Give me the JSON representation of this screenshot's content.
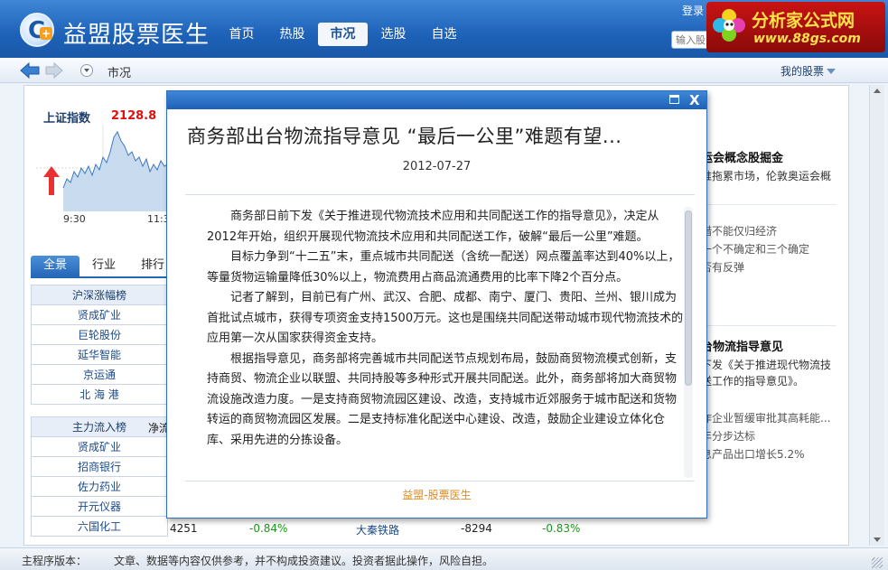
{
  "app": {
    "title": "益盟股票医生",
    "login": "登录",
    "search_placeholder": "输入股"
  },
  "nav": {
    "items": [
      "首页",
      "热股",
      "市况",
      "选股",
      "自选"
    ],
    "active_index": 2
  },
  "watermark": {
    "title": "分析家公式网",
    "url": "www.88gs.com"
  },
  "toolbar": {
    "breadcrumb": "市况",
    "my_stocks": "我的股票"
  },
  "index": {
    "name": "上证指数",
    "value": "2128.8",
    "time_start": "9:30",
    "time_mid": "11:3"
  },
  "subtabs": [
    "全景",
    "行业",
    "排行"
  ],
  "table1": {
    "header": "沪深涨幅榜",
    "rows": [
      "贤成矿业",
      "巨轮股份",
      "延华智能",
      "京运通",
      "北 海 港"
    ]
  },
  "table2": {
    "header": "主力流入榜",
    "header2": "净流",
    "rows": [
      "贤成矿业",
      "招商银行",
      "佐力药业",
      "开元仪器",
      "六国化工"
    ]
  },
  "bottom_row": {
    "amount1": "4251",
    "pct1": "-0.84%",
    "name2": "大秦铁路",
    "amount2": "-8294",
    "pct2": "-0.83%"
  },
  "right_panel": {
    "headline1": "运会概念股掘金",
    "line1": "推拖累市场，伦敦奥运会概",
    "items1": [
      "措不能仅归经济",
      "一个不确定和三个确定",
      "否有反弹"
    ],
    "headline2": "台物流指导意见",
    "line2a": "下发《关于推进现代物流技",
    "line2b": "送工作的指导意见》。",
    "items2": [
      "作企业暂缓审批其高耗能...",
      "年分步达标",
      "息产品出口增长5.2%"
    ]
  },
  "statusbar": {
    "label": "主程序版本：",
    "disclaimer": "文章、数据等内容仅供参考，并不构成投资建议。投资者据此操作，风险自担。"
  },
  "article": {
    "title": "商务部出台物流指导意见 “最后一公里”难题有望...",
    "date": "2012-07-27",
    "paragraphs": [
      "商务部日前下发《关于推进现代物流技术应用和共同配送工作的指导意见》，决定从2012年开始，组织开展现代物流技术应用和共同配送工作，破解“最后一公里”难题。",
      "目标力争到“十二五”末，重点城市共同配送（含统一配送）网点覆盖率达到40%以上，等量货物运输量降低30%以上，物流费用占商品流通费用的比率下降2个百分点。",
      "记者了解到，目前已有广州、武汉、合肥、成都、南宁、厦门、贵阳、兰州、银川成为首批试点城市，获得专项资金支持1500万元。这也是围绕共同配送带动城市现代物流技术的应用第一次从国家获得资金支持。",
      "根据指导意见，商务部将完善城市共同配送节点规划布局，鼓励商贸物流模式创新，支持商贸、物流企业以联盟、共同持股等多种形式开展共同配送。此外，商务部将加大商贸物流设施改造力度。一是支持商贸物流园区建设、改造，支持城市近郊服务于城市配送和货物转运的商贸物流园区发展。二是支持标准化配送中心建设、改造，鼓励企业建设立体化仓库、采用先进的分拣设备。"
    ],
    "footer": "益盟-股票医生"
  },
  "colors": {
    "header_blue": "#1d62b8",
    "index_red": "#dd1111",
    "footer_orange": "#e08a1e"
  }
}
